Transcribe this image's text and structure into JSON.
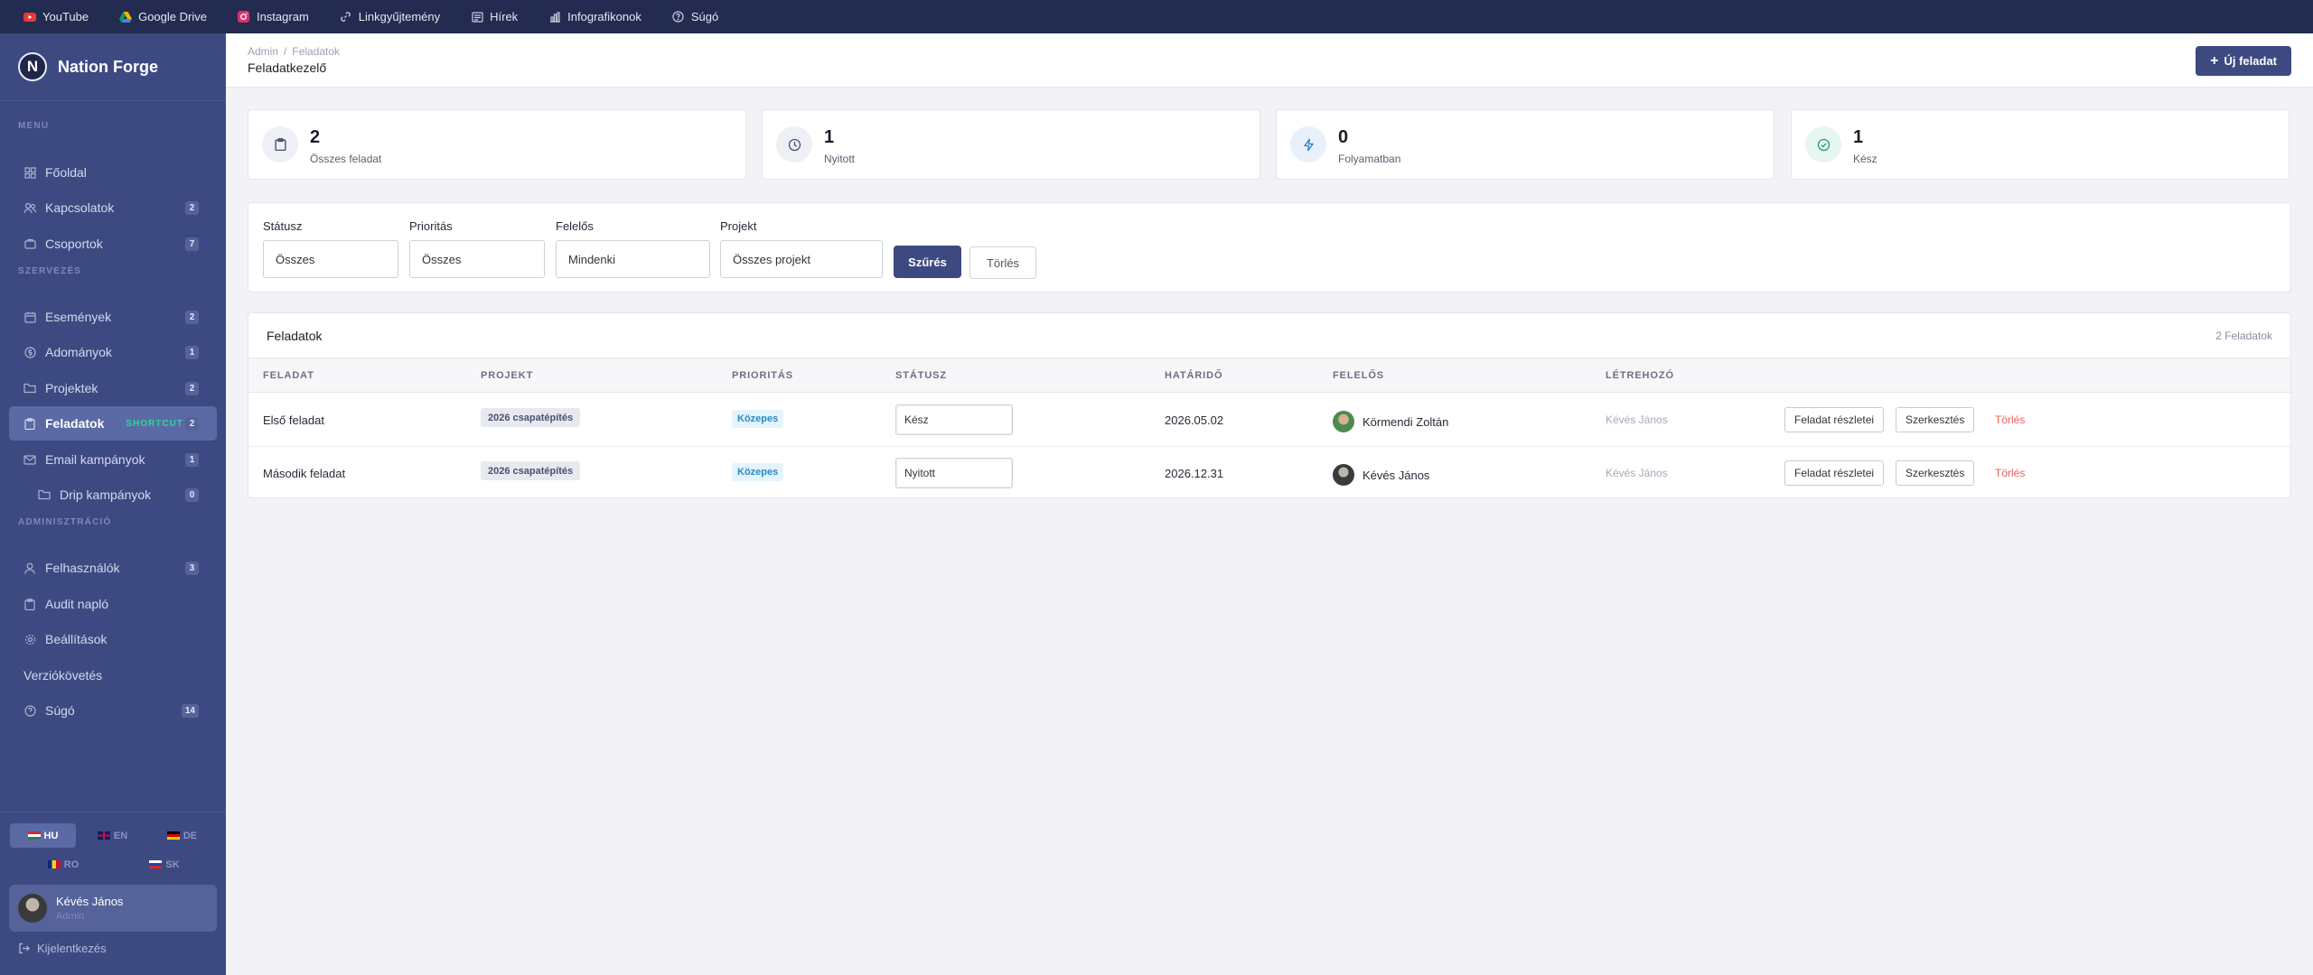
{
  "bookmarks": [
    {
      "label": "YouTube",
      "icon": "youtube-icon"
    },
    {
      "label": "Google Drive",
      "icon": "google-drive-icon"
    },
    {
      "label": "Instagram",
      "icon": "instagram-icon"
    },
    {
      "label": "Linkgyűjtemény",
      "icon": "link-icon"
    },
    {
      "label": "Hírek",
      "icon": "news-icon"
    },
    {
      "label": "Infografikonok",
      "icon": "chart-icon"
    },
    {
      "label": "Súgó",
      "icon": "help-icon"
    }
  ],
  "brand": {
    "logo": "N",
    "name": "Nation Forge"
  },
  "sidebar": {
    "sections": {
      "menu": "MENU",
      "org": "SZERVEZÉS",
      "admin": "ADMINISZTRÁCIÓ"
    },
    "items": [
      {
        "label": "Főoldal",
        "badge": ""
      },
      {
        "label": "Kapcsolatok",
        "badge": "2"
      },
      {
        "label": "Csoportok",
        "badge": "7"
      },
      {
        "label": "Események",
        "badge": "2"
      },
      {
        "label": "Adományok",
        "badge": "1"
      },
      {
        "label": "Projektek",
        "badge": "2"
      },
      {
        "label": "Feladatok",
        "badge": "2",
        "shortcut": "SHORTCUT"
      },
      {
        "label": "Email kampányok",
        "badge": "1"
      },
      {
        "label": "Drip kampányok",
        "badge": "0"
      },
      {
        "label": "Felhasználók",
        "badge": "3"
      },
      {
        "label": "Audit napló",
        "badge": ""
      },
      {
        "label": "Beállítások",
        "badge": ""
      },
      {
        "label": "Verziókövetés",
        "badge": ""
      },
      {
        "label": "Súgó",
        "badge": "14"
      }
    ],
    "languages": [
      "HU",
      "EN",
      "DE",
      "RO",
      "SK"
    ],
    "active_language": "HU",
    "user": {
      "name": "Kévés János",
      "role": "Admin"
    },
    "logout": "Kijelentkezés"
  },
  "header": {
    "breadcrumb": [
      "Admin",
      "/",
      "Feladatok"
    ],
    "title": "Feladatkezelő",
    "new_button": "Új feladat"
  },
  "stats": [
    {
      "value": "2",
      "label": "Összes feladat"
    },
    {
      "value": "1",
      "label": "Nyitott"
    },
    {
      "value": "0",
      "label": "Folyamatban"
    },
    {
      "value": "1",
      "label": "Kész"
    }
  ],
  "filters": {
    "status": {
      "label": "Státusz",
      "value": "Összes"
    },
    "priority": {
      "label": "Prioritás",
      "value": "Összes"
    },
    "owner": {
      "label": "Felelős",
      "value": "Mindenki"
    },
    "project": {
      "label": "Projekt",
      "value": "Összes projekt"
    },
    "apply": "Szűrés",
    "clear": "Törlés"
  },
  "table": {
    "title": "Feladatok",
    "count": "2 Feladatok",
    "columns": [
      "FELADAT",
      "PROJEKT",
      "PRIORITÁS",
      "STÁTUSZ",
      "HATÁRIDŐ",
      "FELELŐS",
      "LÉTREHOZÓ"
    ],
    "rows": [
      {
        "task": "Első feladat",
        "project": "2026 csapatépítés",
        "priority": "Közepes",
        "status": "Kész",
        "deadline": "2026.05.02",
        "owner": "Körmendi Zoltán",
        "creator": "Kévés János"
      },
      {
        "task": "Második feladat",
        "project": "2026 csapatépítés",
        "priority": "Közepes",
        "status": "Nyitott",
        "deadline": "2026.12.31",
        "owner": "Kévés János",
        "creator": "Kévés János"
      }
    ],
    "actions": {
      "details": "Feladat részletei",
      "edit": "Szerkesztés",
      "delete": "Törlés"
    }
  },
  "colors": {
    "sidebar": "#3d4a82",
    "topbar": "#232c50",
    "primary": "#3d4a82",
    "danger": "#e0605a",
    "shortcut": "#2fd4a0"
  }
}
